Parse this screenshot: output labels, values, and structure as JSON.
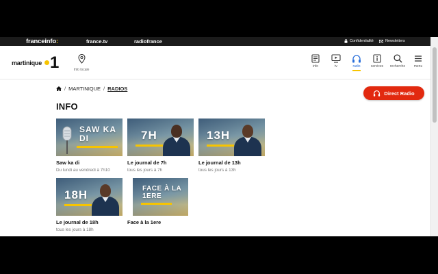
{
  "topbar": {
    "brand": "franceinfo",
    "brand_colon": ":",
    "links": [
      "france.tv",
      "radiofrance"
    ],
    "privacy": "Confidentialité",
    "newsletters": "Newsletters"
  },
  "header": {
    "logo_name": "martinique",
    "logo_number": "1",
    "locale_label": "Info locale",
    "nav": [
      {
        "label": "info",
        "icon": "newspaper-icon"
      },
      {
        "label": "tv",
        "icon": "tv-icon"
      },
      {
        "label": "radio",
        "icon": "headphones-icon",
        "active": true
      },
      {
        "label": "services",
        "icon": "info-box-icon"
      },
      {
        "label": "recherche",
        "icon": "search-icon"
      },
      {
        "label": "menu",
        "icon": "hamburger-icon"
      }
    ]
  },
  "breadcrumb": {
    "sep1": "/",
    "item1": "MARTINIQUE",
    "sep2": "/",
    "item2": "RADIOS"
  },
  "direct_radio": "Direct Radio",
  "section_title": "INFO",
  "cards": [
    {
      "thumb_text": "SAW KA DI",
      "title": "Saw ka di",
      "sub": "Du lundi au vendredi à 7h10"
    },
    {
      "thumb_text": "7H",
      "title": "Le journal de 7h",
      "sub": "tous les jours à 7h"
    },
    {
      "thumb_text": "13H",
      "title": "Le journal de 13h",
      "sub": "tous les jours à 13h"
    },
    {
      "thumb_text": "18H",
      "title": "Le journal de 18h",
      "sub": "tous les jours à 18h"
    },
    {
      "thumb_text": "FACE À LA 1ERE",
      "title": "Face à la 1ere",
      "sub": ""
    }
  ],
  "colors": {
    "accent_yellow": "#f7c400",
    "direct_red": "#e2290f",
    "active_blue": "#2a6fdb"
  }
}
